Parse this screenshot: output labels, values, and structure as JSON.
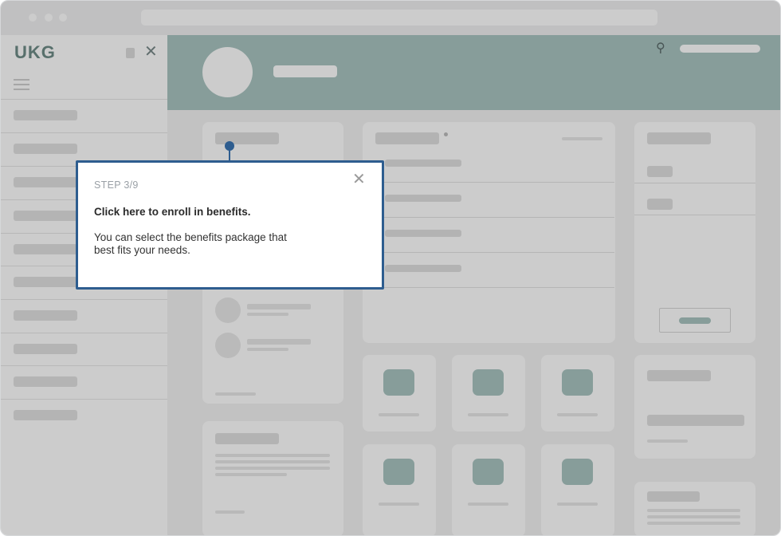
{
  "app": {
    "logo": "UKG"
  },
  "tooltip": {
    "step": "STEP 3/9",
    "title": "Click here to enroll in benefits.",
    "body": "You can select the benefits package that best fits your needs."
  },
  "colors": {
    "accent": "#2e5d8f",
    "header": "#a9c5c1"
  },
  "icons": [
    "close-icon",
    "menu-icon",
    "search-icon"
  ]
}
